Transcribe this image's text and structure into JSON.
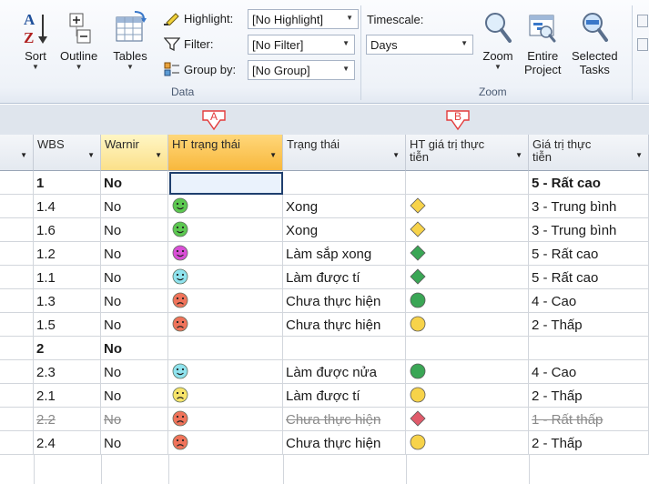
{
  "ribbon": {
    "sort": "Sort",
    "outline": "Outline",
    "tables": "Tables",
    "highlight_label": "Highlight:",
    "highlight_value": "[No Highlight]",
    "filter_label": "Filter:",
    "filter_value": "[No Filter]",
    "groupby_label": "Group by:",
    "groupby_value": "[No Group]",
    "data_group": "Data",
    "timescale_label": "Timescale:",
    "timescale_value": "Days",
    "zoom": "Zoom",
    "entire_project": [
      "Entire",
      "Project"
    ],
    "selected_tasks": [
      "Selected",
      "Tasks"
    ],
    "zoom_group": "Zoom"
  },
  "markers": {
    "a": "A",
    "b": "B"
  },
  "columns": {
    "wbs": "WBS",
    "warning": "Warnir",
    "ht_status": "HT trạng thái",
    "status": "Trạng thái",
    "ht_value": [
      "HT giá trị thực",
      "tiễn"
    ],
    "value": [
      "Giá trị thực",
      "tiễn"
    ]
  },
  "colors": {
    "smiley_green": "#5cc850",
    "smiley_magenta": "#d94fd6",
    "smiley_cyan": "#8fe3ee",
    "smiley_red": "#f0735a",
    "smiley_yellow": "#f7e46a",
    "diamond_yellow": "#f7d34a",
    "diamond_green": "#3aa655",
    "diamond_red": "#e05a6a",
    "circle_green": "#3aa655",
    "circle_yellow": "#f7d34a",
    "marker_red": "#e33c3c"
  },
  "rows": [
    {
      "wbs": "1",
      "warn": "No",
      "ht_status": "",
      "status": "",
      "ht_value": "",
      "value": "5 - Rất cao",
      "bold": true,
      "strike": false
    },
    {
      "wbs": "1.4",
      "warn": "No",
      "ht_status": "smiley-green",
      "status": "Xong",
      "ht_value": "diamond-yellow",
      "value": "3 - Trung bình",
      "bold": false,
      "strike": false
    },
    {
      "wbs": "1.6",
      "warn": "No",
      "ht_status": "smiley-green",
      "status": "Xong",
      "ht_value": "diamond-yellow",
      "value": "3 - Trung bình",
      "bold": false,
      "strike": false
    },
    {
      "wbs": "1.2",
      "warn": "No",
      "ht_status": "smiley-magenta",
      "status": "Làm sắp xong",
      "ht_value": "diamond-green",
      "value": "5 - Rất cao",
      "bold": false,
      "strike": false
    },
    {
      "wbs": "1.1",
      "warn": "No",
      "ht_status": "smiley-cyan",
      "status": "Làm được tí",
      "ht_value": "diamond-green",
      "value": "5 - Rất cao",
      "bold": false,
      "strike": false
    },
    {
      "wbs": "1.3",
      "warn": "No",
      "ht_status": "smiley-red",
      "status": "Chưa thực hiện",
      "ht_value": "circle-green",
      "value": "4 - Cao",
      "bold": false,
      "strike": false
    },
    {
      "wbs": "1.5",
      "warn": "No",
      "ht_status": "smiley-red",
      "status": "Chưa thực hiện",
      "ht_value": "circle-yellow",
      "value": "2 - Thấp",
      "bold": false,
      "strike": false
    },
    {
      "wbs": "2",
      "warn": "No",
      "ht_status": "",
      "status": "",
      "ht_value": "",
      "value": "",
      "bold": true,
      "strike": false
    },
    {
      "wbs": "2.3",
      "warn": "No",
      "ht_status": "smiley-cyan",
      "status": "Làm được nửa",
      "ht_value": "circle-green",
      "value": "4 - Cao",
      "bold": false,
      "strike": false
    },
    {
      "wbs": "2.1",
      "warn": "No",
      "ht_status": "smiley-yellow",
      "status": "Làm được tí",
      "ht_value": "circle-yellow",
      "value": "2 - Thấp",
      "bold": false,
      "strike": false
    },
    {
      "wbs": "2.2",
      "warn": "No",
      "ht_status": "smiley-red",
      "status": "Chưa thực hiện",
      "ht_value": "diamond-red",
      "value": "1 - Rất thấp",
      "bold": false,
      "strike": true
    },
    {
      "wbs": "2.4",
      "warn": "No",
      "ht_status": "smiley-red",
      "status": "Chưa thực hiện",
      "ht_value": "circle-yellow",
      "value": "2 - Thấp",
      "bold": false,
      "strike": false
    }
  ]
}
